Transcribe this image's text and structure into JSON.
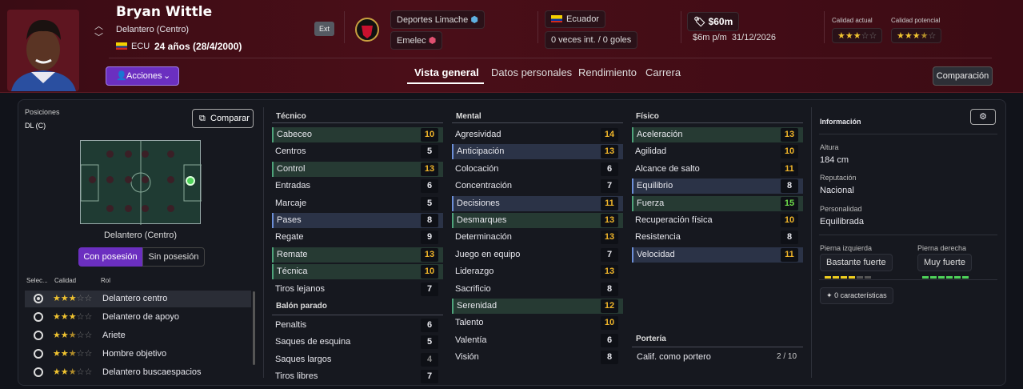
{
  "player": {
    "name": "Bryan Wittle",
    "position": "Delantero (Centro)",
    "nation_code": "ECU",
    "age_text": "24 años (28/4/2000)",
    "ext": "Ext"
  },
  "clubs": {
    "club1": "Deportes Limache",
    "club2": "Emelec"
  },
  "nationality": {
    "country": "Ecuador",
    "caps": "0 veces int. / 0 goles"
  },
  "contract": {
    "value": "$60m",
    "wage_expiry": "$6m p/m  31/12/2026"
  },
  "quality": {
    "current_label": "Calidad actual",
    "potential_label": "Calidad potencial",
    "current_stars": 3,
    "potential_stars": 3.5
  },
  "actions": {
    "label": "Acciones"
  },
  "tabs": [
    "Vista general",
    "Datos personales",
    "Rendimiento",
    "Carrera"
  ],
  "comparison_button": "Comparación",
  "left": {
    "positions_label": "Posiciones",
    "positions_value": "DL (C)",
    "compare": "Comparar",
    "pitch_label": "Delantero (Centro)",
    "toggle_on": "Con posesión",
    "toggle_off": "Sin posesión",
    "col_select": "Selec...",
    "col_quality": "Calidad",
    "col_role": "Rol",
    "roles": [
      {
        "name": "Delantero centro",
        "stars": 3
      },
      {
        "name": "Delantero de apoyo",
        "stars": 3
      },
      {
        "name": "Ariete",
        "stars": 2.5
      },
      {
        "name": "Hombre objetivo",
        "stars": 2.5
      },
      {
        "name": "Delantero buscaespacios",
        "stars": 2.5
      }
    ]
  },
  "tecnico": {
    "title": "Técnico",
    "attrs": [
      [
        "Cabeceo",
        "10",
        "g",
        "y"
      ],
      [
        "Centros",
        "5",
        "",
        "w"
      ],
      [
        "Control",
        "13",
        "g",
        "y"
      ],
      [
        "Entradas",
        "6",
        "",
        "w"
      ],
      [
        "Marcaje",
        "5",
        "",
        "w"
      ],
      [
        "Pases",
        "8",
        "b",
        "w"
      ],
      [
        "Regate",
        "9",
        "",
        "w"
      ],
      [
        "Remate",
        "13",
        "g",
        "y"
      ],
      [
        "Técnica",
        "10",
        "g",
        "y"
      ],
      [
        "Tiros lejanos",
        "7",
        "",
        "w"
      ]
    ]
  },
  "balon": {
    "title": "Balón parado",
    "attrs": [
      [
        "Penaltis",
        "6",
        "",
        "w"
      ],
      [
        "Saques de esquina",
        "5",
        "",
        "w"
      ],
      [
        "Saques largos",
        "4",
        "",
        "gr"
      ],
      [
        "Tiros libres",
        "7",
        "",
        "w"
      ]
    ]
  },
  "mental": {
    "title": "Mental",
    "attrs": [
      [
        "Agresividad",
        "14",
        "",
        "y"
      ],
      [
        "Anticipación",
        "13",
        "b",
        "y"
      ],
      [
        "Colocación",
        "6",
        "",
        "w"
      ],
      [
        "Concentración",
        "7",
        "",
        "w"
      ],
      [
        "Decisiones",
        "11",
        "b",
        "y"
      ],
      [
        "Desmarques",
        "13",
        "g",
        "y"
      ],
      [
        "Determinación",
        "13",
        "",
        "y"
      ],
      [
        "Juego en equipo",
        "7",
        "",
        "w"
      ],
      [
        "Liderazgo",
        "13",
        "",
        "y"
      ],
      [
        "Sacrificio",
        "8",
        "",
        "w"
      ],
      [
        "Serenidad",
        "12",
        "g",
        "y"
      ],
      [
        "Talento",
        "10",
        "",
        "y"
      ],
      [
        "Valentía",
        "6",
        "",
        "w"
      ],
      [
        "Visión",
        "8",
        "",
        "w"
      ]
    ]
  },
  "fisico": {
    "title": "Físico",
    "attrs": [
      [
        "Aceleración",
        "13",
        "g",
        "y"
      ],
      [
        "Agilidad",
        "10",
        "",
        "y"
      ],
      [
        "Alcance de salto",
        "11",
        "",
        "y"
      ],
      [
        "Equilibrio",
        "8",
        "b",
        "w"
      ],
      [
        "Fuerza",
        "15",
        "g",
        "gn"
      ],
      [
        "Recuperación física",
        "10",
        "",
        "y"
      ],
      [
        "Resistencia",
        "8",
        "",
        "w"
      ],
      [
        "Velocidad",
        "11",
        "b",
        "y"
      ]
    ]
  },
  "porteria": {
    "title": "Portería",
    "label": "Calif. como portero",
    "value": "2 / 10"
  },
  "info": {
    "title": "Información",
    "height_label": "Altura",
    "height": "184 cm",
    "rep_label": "Reputación",
    "rep": "Nacional",
    "pers_label": "Personalidad",
    "pers": "Equilibrada",
    "left_foot_label": "Pierna izquierda",
    "left_foot": "Bastante fuerte",
    "right_foot_label": "Pierna derecha",
    "right_foot": "Muy fuerte",
    "left_foot_level": 4,
    "right_foot_level": 6,
    "traits": "0 características"
  }
}
